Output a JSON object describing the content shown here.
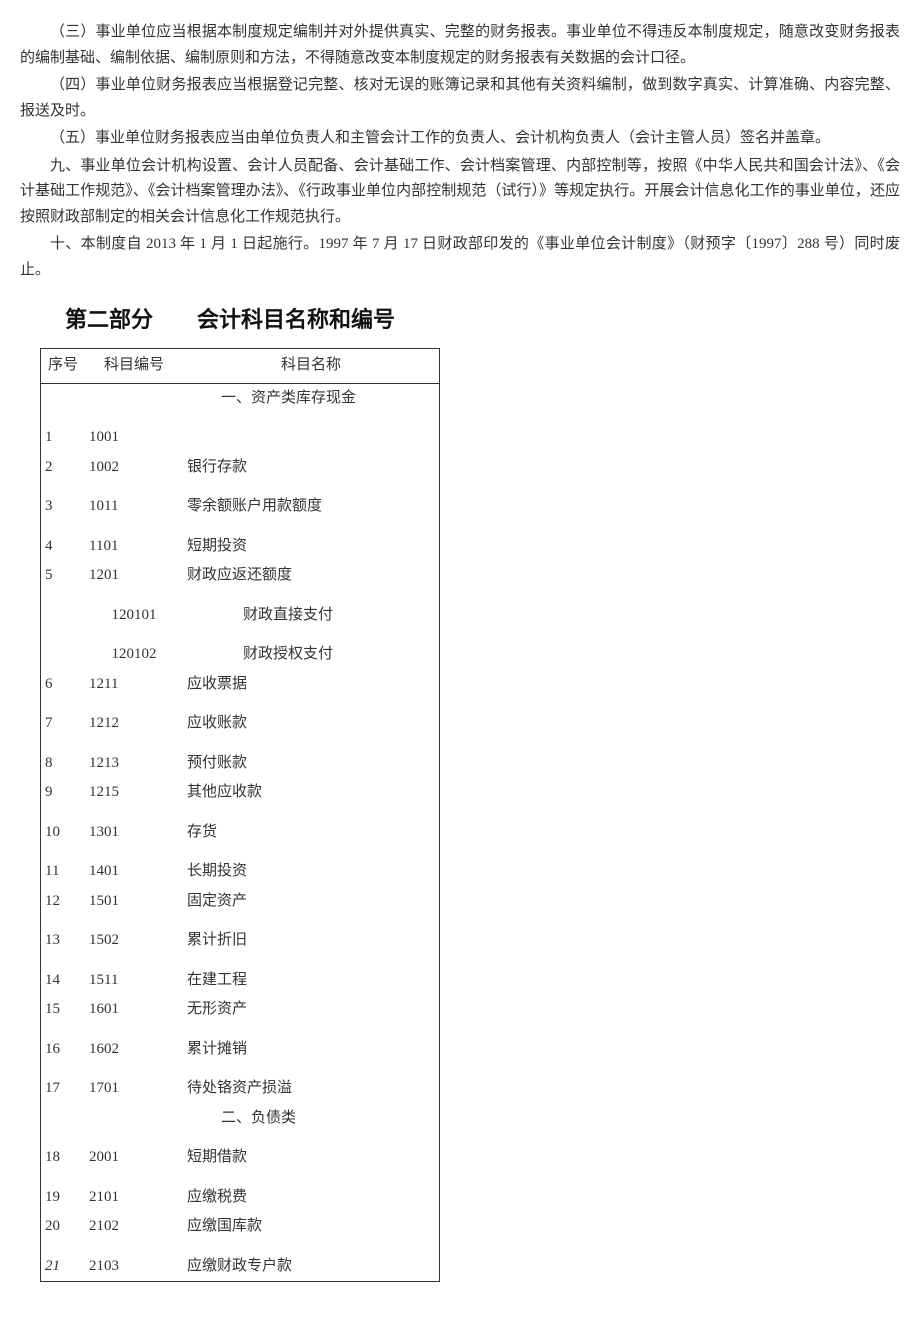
{
  "paragraphs": {
    "p1": "（三）事业单位应当根据本制度规定编制并对外提供真实、完整的财务报表。事业单位不得违反本制度规定，随意改变财务报表的编制基础、编制依据、编制原则和方法，不得随意改变本制度规定的财务报表有关数据的会计口径。",
    "p2": "（四）事业单位财务报表应当根据登记完整、核对无误的账簿记录和其他有关资料编制，做到数字真实、计算准确、内容完整、报送及时。",
    "p3": "（五）事业单位财务报表应当由单位负责人和主管会计工作的负责人、会计机构负责人（会计主管人员）签名并盖章。",
    "p4": "九、事业单位会计机构设置、会计人员配备、会计基础工作、会计档案管理、内部控制等，按照《中华人民共和国会计法》、《会计基础工作规范》、《会计档案管理办法》、《行政事业单位内部控制规范（试行）》等规定执行。开展会计信息化工作的事业单位，还应按照财政部制定的相关会计信息化工作规范执行。",
    "p5": "十、本制度自 2013 年 1 月 1 日起施行。1997 年 7 月 17 日财政部印发的《事业单位会计制度》（财预字〔1997〕288 号）同时废止。"
  },
  "section_heading": "第二部分　　会计科目名称和编号",
  "table": {
    "headers": {
      "seq": "序号",
      "code": "科目编号",
      "name": "科目名称"
    },
    "category_asset": "一、资产类库存现金",
    "category_liability": "二、负债类",
    "rows": [
      {
        "seq": "1",
        "code": "1001",
        "name": ""
      },
      {
        "seq": "2",
        "code": "1002",
        "name": "银行存款"
      },
      {
        "seq": "3",
        "code": "1011",
        "name": "零余额账户用款额度"
      },
      {
        "seq": "4",
        "code": "1101",
        "name": "短期投资"
      },
      {
        "seq": "5",
        "code": "1201",
        "name": "财政应返还额度"
      },
      {
        "seq": "",
        "code": "120101",
        "name": "财政直接支付",
        "sub": true
      },
      {
        "seq": "",
        "code": "120102",
        "name": "财政授权支付",
        "sub": true
      },
      {
        "seq": "6",
        "code": "1211",
        "name": "应收票据"
      },
      {
        "seq": "7",
        "code": "1212",
        "name": "应收账款"
      },
      {
        "seq": "8",
        "code": "1213",
        "name": "预付账款"
      },
      {
        "seq": "9",
        "code": "1215",
        "name": "其他应收款"
      },
      {
        "seq": "10",
        "code": "1301",
        "name": "存货"
      },
      {
        "seq": "11",
        "code": "1401",
        "name": "长期投资"
      },
      {
        "seq": "12",
        "code": "1501",
        "name": "固定资产"
      },
      {
        "seq": "13",
        "code": "1502",
        "name": "累计折旧"
      },
      {
        "seq": "14",
        "code": "1511",
        "name": "在建工程"
      },
      {
        "seq": "15",
        "code": "1601",
        "name": "无形资产"
      },
      {
        "seq": "16",
        "code": "1602",
        "name": "累计摊销"
      },
      {
        "seq": "17",
        "code": "1701",
        "name": "待处铬资产损溢"
      },
      {
        "seq": "18",
        "code": "2001",
        "name": "短期借款"
      },
      {
        "seq": "19",
        "code": "2101",
        "name": "应缴税费"
      },
      {
        "seq": "20",
        "code": "2102",
        "name": "应缴国库款"
      },
      {
        "seq": "21",
        "code": "2103",
        "name": "应缴财政专户款",
        "italic": true
      }
    ]
  }
}
